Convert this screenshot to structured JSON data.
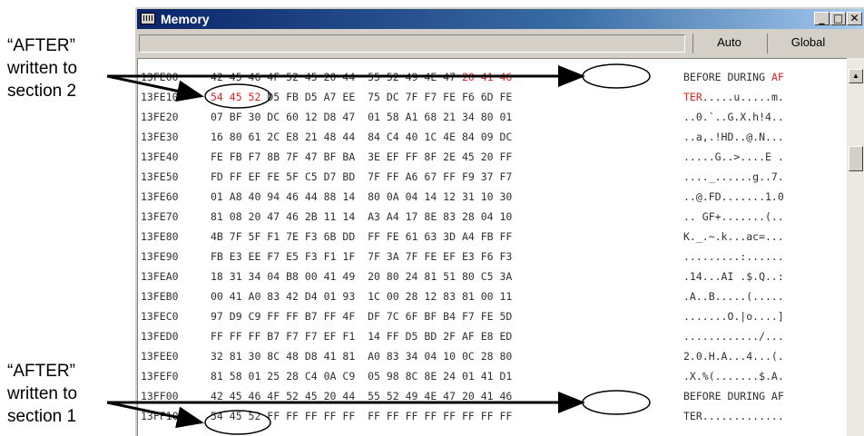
{
  "window": {
    "title": "Memory",
    "buttons": {
      "minimize": "_",
      "maximize": "□",
      "close": "✕"
    }
  },
  "toolbar": {
    "address_value": "",
    "auto_label": "Auto",
    "global_label": "Global"
  },
  "callouts": {
    "top": [
      "“AFTER”",
      "written to",
      "section 2"
    ],
    "bottom": [
      "“AFTER”",
      "written to",
      "section 1"
    ]
  },
  "colors": {
    "highlight": "#e02020",
    "titlebar": "#0a246a"
  },
  "rows": [
    {
      "addr": "13FE00",
      "hex": "42 45 46 4F 52 45 20 44  55 52 49 4E 47 20 41 46",
      "ascii": "BEFORE DURING AF"
    },
    {
      "addr": "13FE10",
      "hex": "54 45 52 D5 FB D5 A7 EE  75 DC 7F F7 FE F6 6D FE",
      "ascii": "TER.....u.....m."
    },
    {
      "addr": "13FE20",
      "hex": "07 BF 30 DC 60 12 D8 47  01 58 A1 68 21 34 80 01",
      "ascii": "..0.`..G.X.h!4.."
    },
    {
      "addr": "13FE30",
      "hex": "16 80 61 2C E8 21 48 44  84 C4 40 1C 4E 84 09 DC",
      "ascii": "..a,.!HD..@.N..."
    },
    {
      "addr": "13FE40",
      "hex": "FE FB F7 8B 7F 47 BF BA  3E EF FF 8F 2E 45 20 FF",
      "ascii": ".....G..>....E ."
    },
    {
      "addr": "13FE50",
      "hex": "FD FF EF FE 5F C5 D7 BD  7F FF A6 67 FF F9 37 F7",
      "ascii": "...._......g..7."
    },
    {
      "addr": "13FE60",
      "hex": "01 A8 40 94 46 44 88 14  80 0A 04 14 12 31 10 30",
      "ascii": "..@.FD.......1.0"
    },
    {
      "addr": "13FE70",
      "hex": "81 08 20 47 46 2B 11 14  A3 A4 17 8E 83 28 04 10",
      "ascii": ".. GF+.......(.."
    },
    {
      "addr": "13FE80",
      "hex": "4B 7F 5F F1 7E F3 6B DD  FF FE 61 63 3D A4 FB FF",
      "ascii": "K._.~.k...ac=..."
    },
    {
      "addr": "13FE90",
      "hex": "FB E3 EE F7 E5 F3 F1 1F  7F 3A 7F FE EF E3 F6 F3",
      "ascii": ".........:......"
    },
    {
      "addr": "13FEA0",
      "hex": "18 31 34 04 B8 00 41 49  20 80 24 81 51 80 C5 3A",
      "ascii": ".14...AI .$.Q..:"
    },
    {
      "addr": "13FEB0",
      "hex": "00 41 A0 83 42 D4 01 93  1C 00 28 12 83 81 00 11",
      "ascii": ".A..B.....(....."
    },
    {
      "addr": "13FEC0",
      "hex": "97 D9 C9 FF FF B7 FF 4F  DF 7C 6F BF B4 F7 FE 5D",
      "ascii": ".......O.|o....]"
    },
    {
      "addr": "13FED0",
      "hex": "FF FF FF B7 F7 F7 EF F1  14 FF D5 BD 2F AF E8 ED",
      "ascii": "............/..."
    },
    {
      "addr": "13FEE0",
      "hex": "32 81 30 8C 48 D8 41 81  A0 83 34 04 10 0C 28 80",
      "ascii": "2.0.H.A...4...(."
    },
    {
      "addr": "13FEF0",
      "hex": "81 58 01 25 28 C4 0A C9  05 98 8C 8E 24 01 41 D1",
      "ascii": ".X.%(.......$.A."
    },
    {
      "addr": "13FF00",
      "hex": "42 45 46 4F 52 45 20 44  55 52 49 4E 47 20 41 46",
      "ascii": "BEFORE DURING AF"
    },
    {
      "addr": "13FF10",
      "hex": "54 45 52 FF FF FF FF FF  FF FF FF FF FF FF FF FF",
      "ascii": "TER............."
    }
  ]
}
